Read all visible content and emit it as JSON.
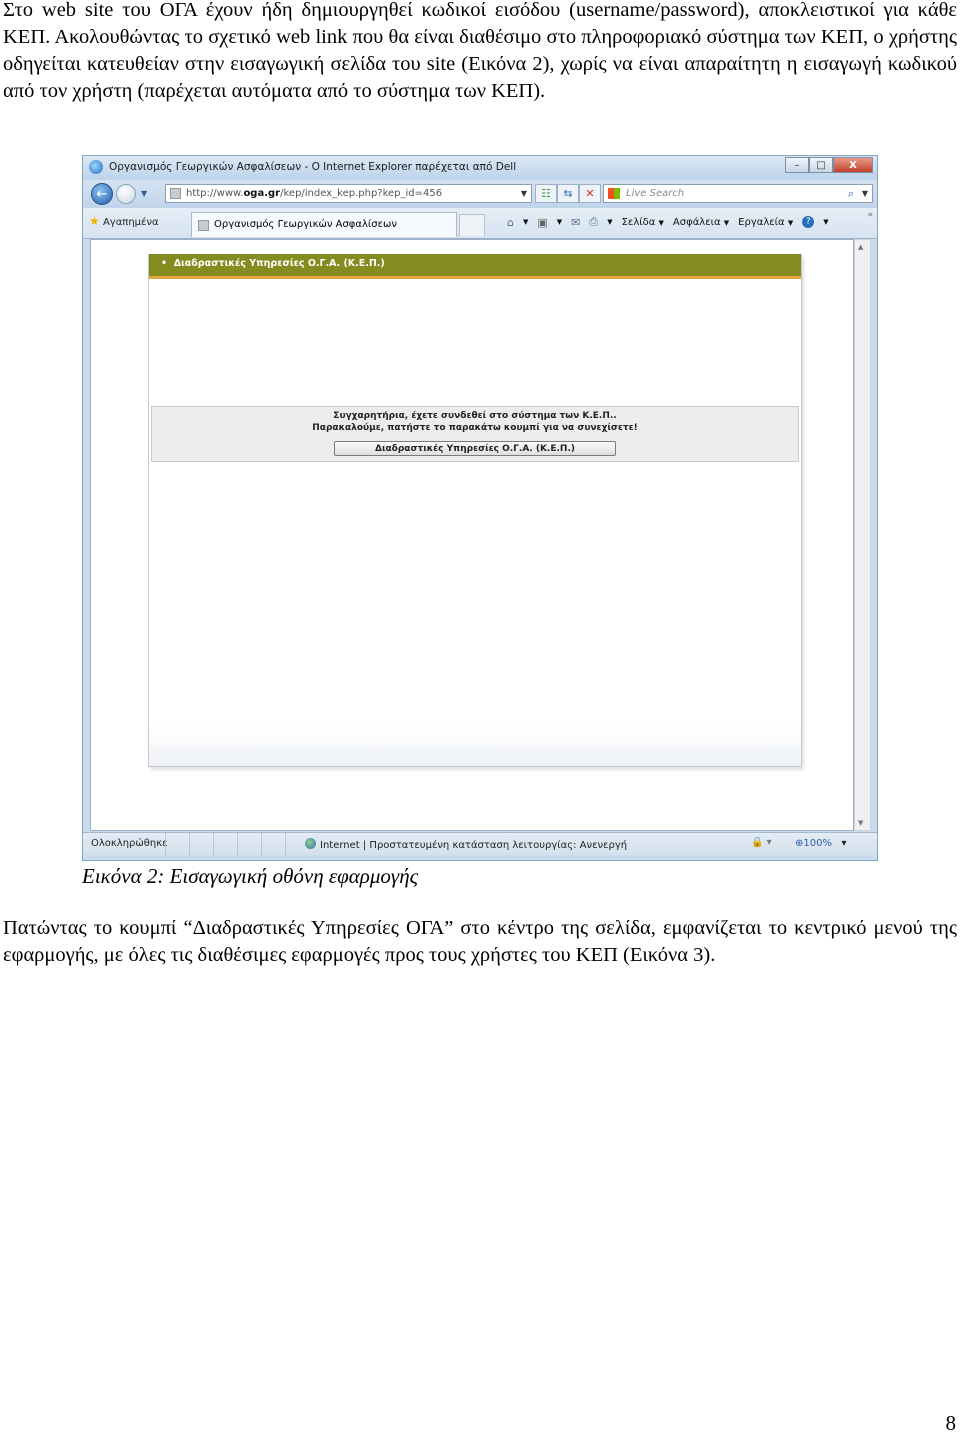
{
  "document": {
    "paragraph1": "Στο web site του ΟΓΑ έχουν ήδη δημιουργηθεί κωδικοί εισόδου (username/password), αποκλειστικοί για κάθε ΚΕΠ. Ακολουθώντας το σχετικό web link που θα είναι διαθέσιμο στο πληροφοριακό σύστημα των ΚΕΠ, ο χρήστης οδηγείται κατευθείαν στην εισαγωγική σελίδα του site (Εικόνα 2), χωρίς να είναι απαραίτητη η εισαγωγή κωδικού από τον χρήστη (παρέχεται αυτόματα από το σύστημα των ΚΕΠ).",
    "caption": "Εικόνα 2: Εισαγωγική οθόνη εφαρμογής",
    "paragraph2": "Πατώντας το κουμπί “Διαδραστικές Υπηρεσίες ΟΓΑ” στο κέντρο της σελίδα, εμφανίζεται το κεντρικό μενού της εφαρμογής, με όλες τις διαθέσιμες εφαρμογές προς τους χρήστες του ΚΕΠ (Εικόνα 3).",
    "page_number": "8"
  },
  "browser": {
    "title": "Οργανισμός Γεωργικών Ασφαλίσεων - Ο Internet Explorer παρέχεται από Dell",
    "window_buttons": {
      "minimize": "–",
      "maximize": "□",
      "close": "X"
    },
    "address": {
      "prefix": "http://www.",
      "domain": "oga.gr",
      "path": "/kep/index_kep.php?kep_id=456"
    },
    "search_placeholder": "Live Search",
    "favorites_label": "Αγαπημένα",
    "tab_label": "Οργανισμός Γεωργικών Ασφαλίσεων",
    "commands": {
      "page": "Σελίδα",
      "safety": "Ασφάλεια",
      "tools": "Εργαλεία"
    },
    "status": {
      "done": "Ολοκληρώθηκε",
      "zone": "Internet | Προστατευμένη κατάσταση λειτουργίας: Ανενεργή",
      "zoom": "100%"
    }
  },
  "web_page": {
    "header_title": "Διαδραστικές Υπηρεσίες Ο.Γ.Α. (Κ.Ε.Π.)",
    "message_line1": "Συγχαρητήρια, έχετε συνδεθεί στο σύστημα των Κ.Ε.Π..",
    "message_line2": "Παρακαλούμε, πατήστε το παρακάτω κουμπί για να συνεχίσετε!",
    "button_label": "Διαδραστικές Υπηρεσίες Ο.Γ.Α. (Κ.Ε.Π.)",
    "colors": {
      "header_bg": "#848c1f",
      "header_accent": "#e2a53e"
    }
  }
}
